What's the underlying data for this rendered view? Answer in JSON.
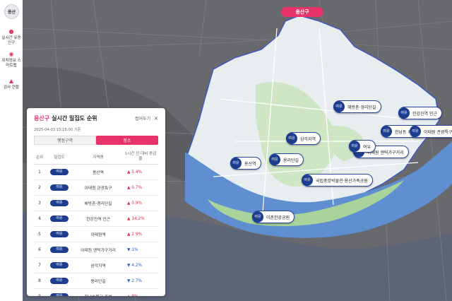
{
  "sidebar": {
    "logo": "용산",
    "items": [
      {
        "label": "실시간 유동인구"
      },
      {
        "label": "위치정보 스마트맵"
      },
      {
        "label": "검사 현황"
      }
    ]
  },
  "map": {
    "district_badge": "용산구"
  },
  "panel": {
    "title_gu": "용산구",
    "title": "실시간 밀집도 순위",
    "collapse_label": "접어두기",
    "close_icon": "✕",
    "timestamp": "2025-04-03 15:15:00 기준",
    "tabs": [
      {
        "label": "행정구역",
        "active": false
      },
      {
        "label": "장소",
        "active": true
      }
    ],
    "columns": {
      "rank": "순위",
      "density": "밀집도",
      "area": "지역명",
      "change": "1시간 전 대비 증감율"
    },
    "rows": [
      {
        "rank": "1",
        "density": "여유",
        "area": "용산역",
        "dir": "up",
        "change": "5.4%"
      },
      {
        "rank": "2",
        "density": "여유",
        "area": "이태원 관광특구",
        "dir": "up",
        "change": "0.7%"
      },
      {
        "rank": "3",
        "density": "여유",
        "area": "해방촌·경리단길",
        "dir": "up",
        "change": "0.9%"
      },
      {
        "rank": "4",
        "density": "여유",
        "area": "한강진역 인근",
        "dir": "up",
        "change": "14.2%"
      },
      {
        "rank": "5",
        "density": "여유",
        "area": "이태원역",
        "dir": "up",
        "change": "2.9%"
      },
      {
        "rank": "6",
        "density": "여유",
        "area": "이태원 앤틱가구거리",
        "dir": "down",
        "change": "1%"
      },
      {
        "rank": "7",
        "density": "여유",
        "area": "삼각지역",
        "dir": "down",
        "change": "4.2%"
      },
      {
        "rank": "8",
        "density": "여유",
        "area": "용리단길",
        "dir": "down",
        "change": "2.7%"
      },
      {
        "rank": "9",
        "density": "여유",
        "area": "한남초목교 주변",
        "dir": "up",
        "change": "8%"
      }
    ]
  },
  "markers": [
    {
      "status": "여유",
      "label": "해방촌·경리단길"
    },
    {
      "status": "여유",
      "label": "한강진역 인근"
    },
    {
      "status": "여유",
      "label": "한남동 카페거리"
    },
    {
      "status": "여유",
      "label": "이태원 관광특구 주변"
    },
    {
      "status": "여유",
      "label": "이태원 앤틱가구거리"
    },
    {
      "status": "여유",
      "label": "여유"
    },
    {
      "status": "여유",
      "label": "삼각지역"
    },
    {
      "status": "여유",
      "label": "용산역"
    },
    {
      "status": "여유",
      "label": "용리단길"
    },
    {
      "status": "여유",
      "label": "국립중앙박물관·용산가족공원"
    },
    {
      "status": "여유",
      "label": "이촌한강공원"
    }
  ],
  "colors": {
    "accent": "#e8336a",
    "status_relaxed": "#1d3d8f",
    "river": "#5f8fd1",
    "district": "#e7ecef"
  }
}
